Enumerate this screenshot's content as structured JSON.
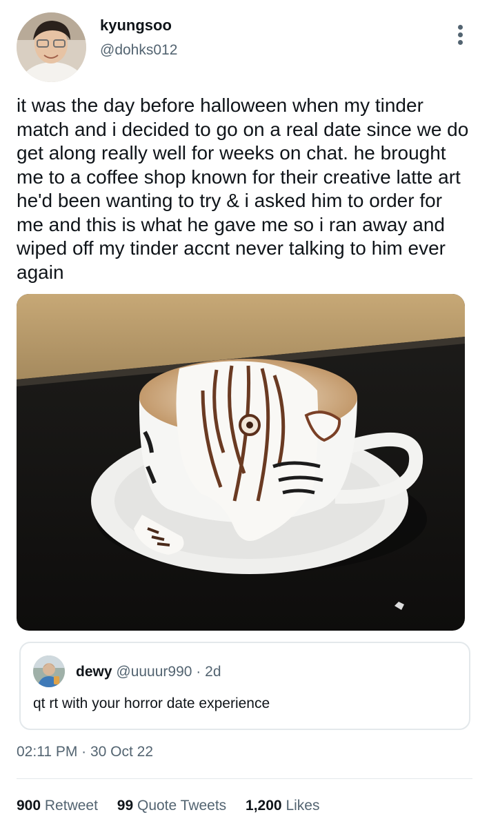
{
  "author": {
    "display_name": "kyungsoo",
    "handle": "@dohks012",
    "avatar_icon": "user-avatar"
  },
  "more_icon": "more-vertical-icon",
  "tweet": {
    "text": "it was the day before halloween when my tinder match and i decided to go on a real date since we do get along really well for weeks on chat. he brought me to a coffee shop known for their creative latte art he'd been wanting to try & i asked him to order for me and this is what he gave me so i ran away and wiped off my tinder accnt never talking to him ever again",
    "media_icon": "latte-art-photo"
  },
  "quoted_tweet": {
    "display_name": "dewy",
    "handle": "@uuuur990",
    "separator": "·",
    "time": "2d",
    "text": "qt rt with your horror date experience"
  },
  "timestamp": "02:11 PM · 30 Oct 22",
  "stats": {
    "retweets_count": "900",
    "retweets_label": "Retweet",
    "quotes_count": "99",
    "quotes_label": "Quote Tweets",
    "likes_count": "1,200",
    "likes_label": "Likes"
  },
  "colors": {
    "text": "#0f1419",
    "secondary": "#536471",
    "border": "#e3e8eb"
  }
}
